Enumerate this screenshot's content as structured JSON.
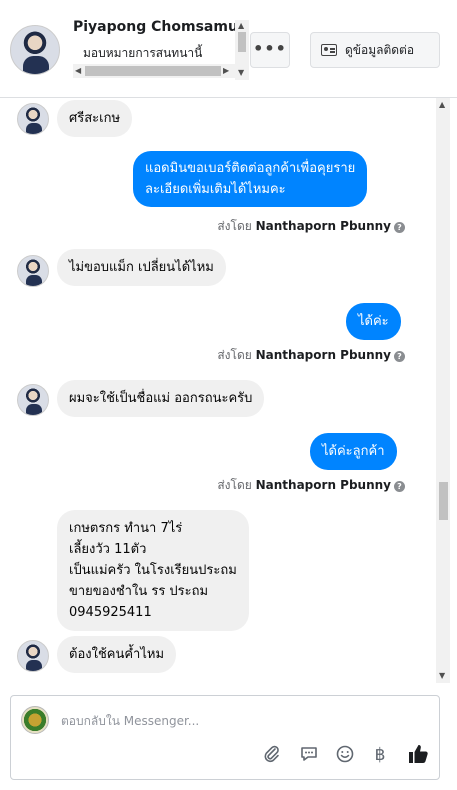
{
  "header": {
    "name": "Piyapong Chomsamut",
    "subtitle": "มอบหมายการสนทนานี้",
    "more_label": "•••",
    "contact_label": "ดูข้อมูลติดต่อ"
  },
  "messages": [
    {
      "direction": "in",
      "text": "ศรีสะเกษ"
    },
    {
      "direction": "out",
      "lines": [
        "แอดมินขอเบอร์ติดต่อลูกค้าเพื่อคุยราย",
        "ละเอียดเพิ่มเติมได้ไหมคะ"
      ],
      "sent_by_prefix": "ส่งโดย",
      "sent_by": "Nanthaporn Pbunny"
    },
    {
      "direction": "in",
      "text": "ไม่ขอบแม็ก เปลี่ยนได้ไหม"
    },
    {
      "direction": "out",
      "text": "ได้ค่ะ",
      "sent_by_prefix": "ส่งโดย",
      "sent_by": "Nanthaporn Pbunny"
    },
    {
      "direction": "in",
      "text": "ผมจะใช้เป็นชื่อแม่ ออกรถนะครับ"
    },
    {
      "direction": "out",
      "text": "ได้ค่ะลูกค้า",
      "sent_by_prefix": "ส่งโดย",
      "sent_by": "Nanthaporn Pbunny"
    },
    {
      "direction": "in",
      "lines": [
        "เกษตรกร ทำนา 7ไร่",
        "เลี้ยงวัว 11ตัว",
        "เป็นแม่ครัว ในโรงเรียนประถม",
        "ขายของชำใน รร ประถม",
        "0945925411"
      ]
    },
    {
      "direction": "in",
      "text": "ต้องใช้คนค้ำไหม"
    }
  ],
  "composer": {
    "placeholder": "ตอบกลับใน Messenger...",
    "tools": [
      "paperclip-icon",
      "speech-bubble-icon",
      "smiley-icon",
      "baht-icon",
      "thumbs-up-icon"
    ],
    "baht_symbol": "฿"
  },
  "colors": {
    "outgoing_bubble": "#0084ff",
    "incoming_bubble": "#f0f0f0",
    "like_icon": "#1c1e21"
  }
}
